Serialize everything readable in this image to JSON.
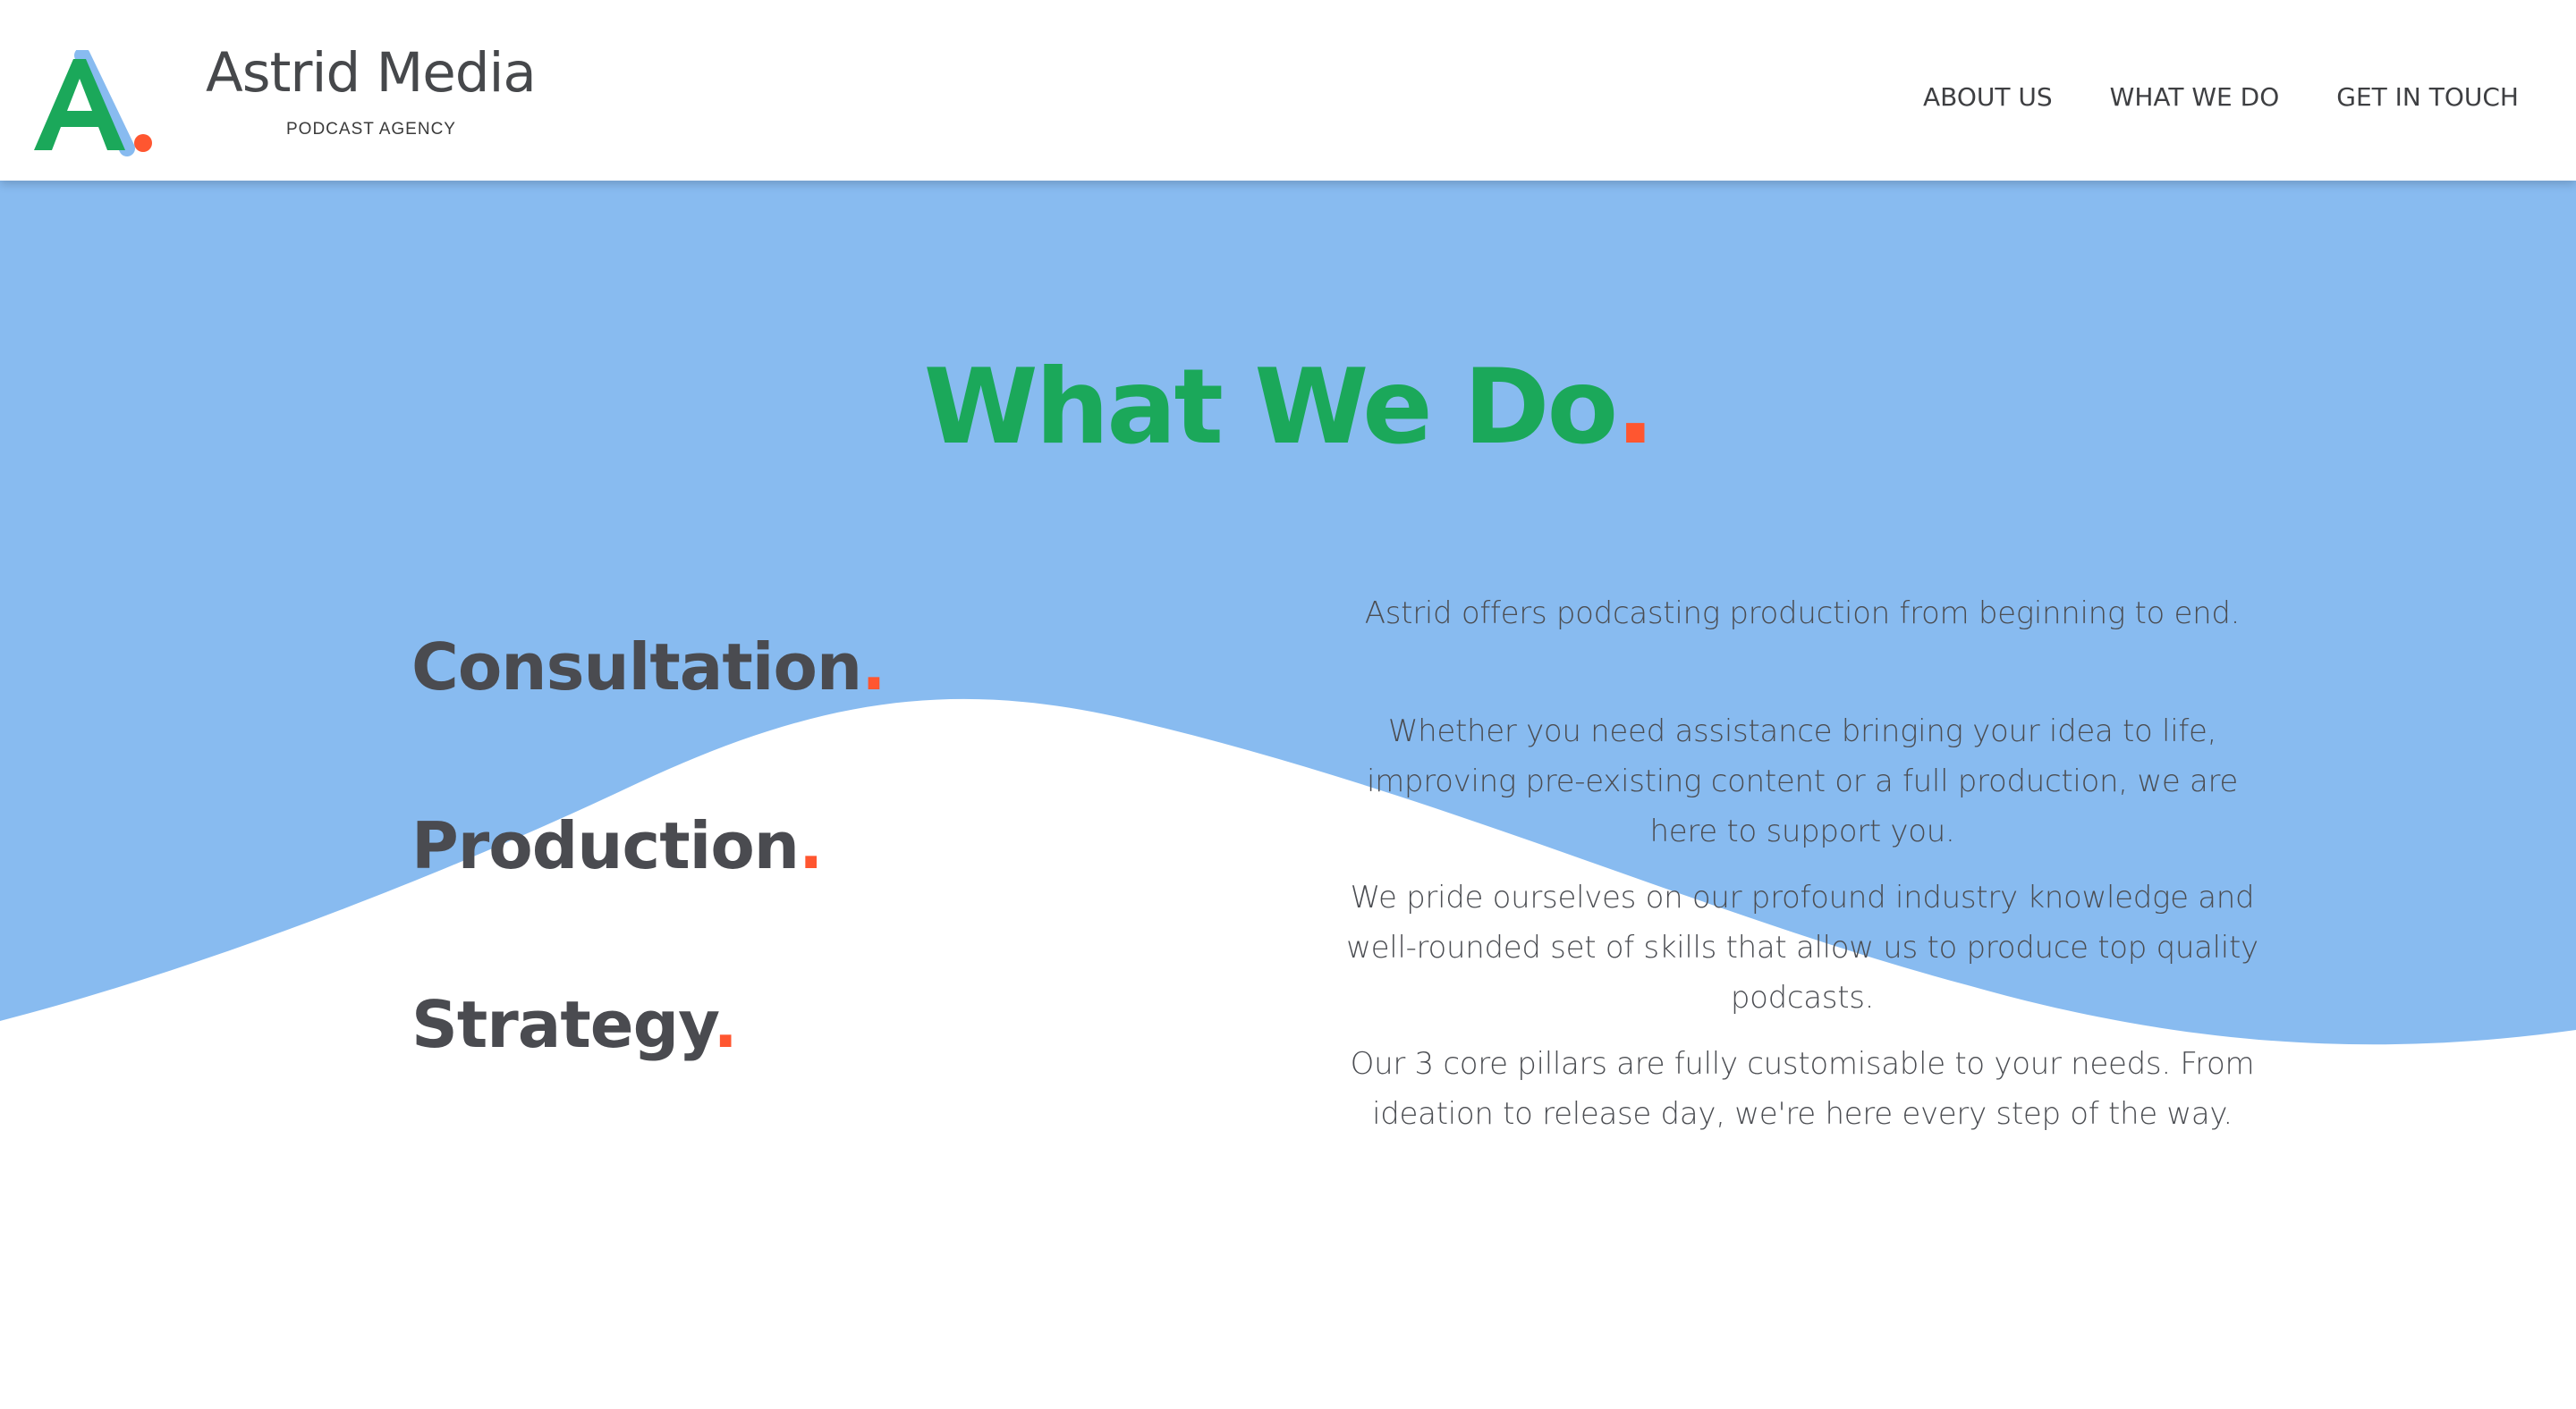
{
  "brand": {
    "name": "Astrid Media",
    "tagline": "PODCAST AGENCY",
    "logo_letter": "A"
  },
  "nav": {
    "items": [
      {
        "label": "ABOUT US"
      },
      {
        "label": "WHAT WE DO"
      },
      {
        "label": "GET IN TOUCH"
      }
    ]
  },
  "section": {
    "title": "What We Do",
    "accent_dot": "."
  },
  "pillars": [
    {
      "label": "Consultation",
      "dot": "."
    },
    {
      "label": "Production",
      "dot": "."
    },
    {
      "label": "Strategy",
      "dot": "."
    }
  ],
  "copy": {
    "paragraphs": [
      "Astrid offers podcasting production from beginning to end.",
      "Whether you need assistance bringing your idea to life, improving pre-existing content or a full production, we are here to support you.",
      "We pride ourselves on our profound industry knowledge and well-rounded set of skills that allow us to produce top quality podcasts.",
      "Our 3 core pillars are fully customisable to your needs. From ideation to release day, we're here every step of the way."
    ]
  },
  "colors": {
    "accent_green": "#1ba85a",
    "accent_orange": "#ff5630",
    "wave_blue": "#88bbf0",
    "text_dark": "#4a4b50"
  }
}
